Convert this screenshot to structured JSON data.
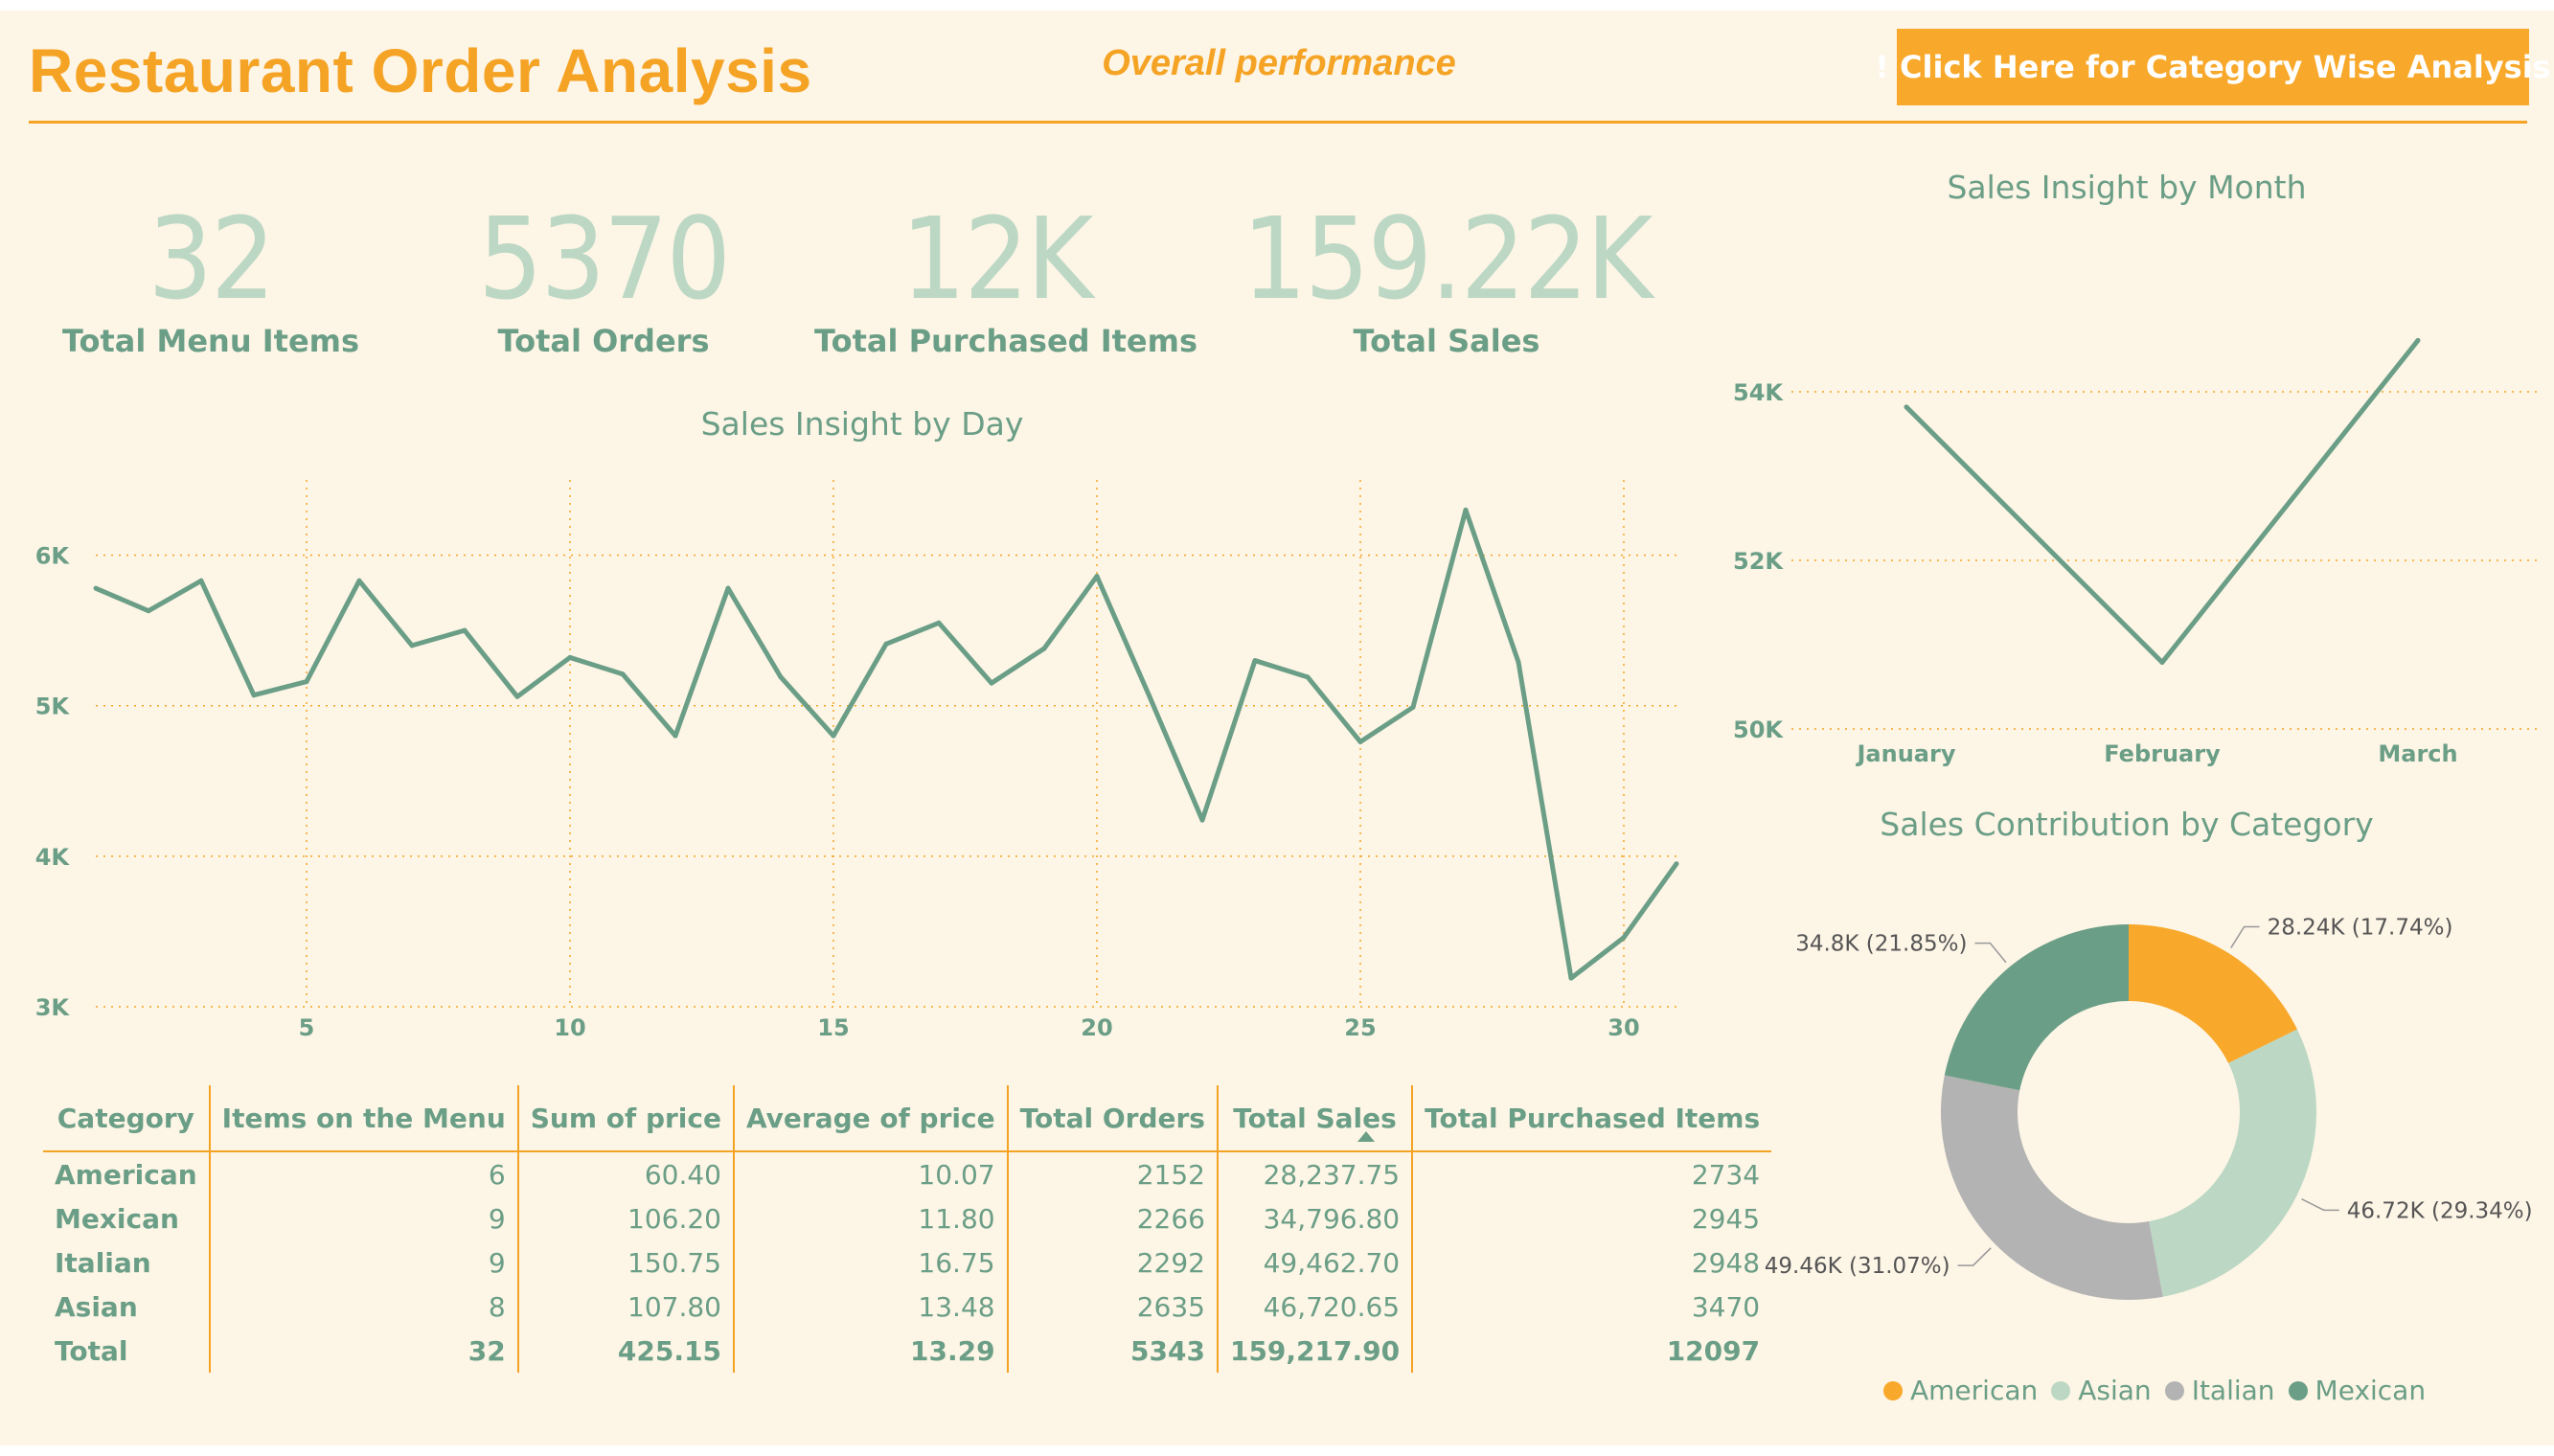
{
  "header": {
    "title": "Restaurant Order Analysis",
    "subtitle": "Overall performance",
    "cta_label": "! Click Here for Category Wise Analysis"
  },
  "kpis": [
    {
      "value": "32",
      "label": "Total Menu Items"
    },
    {
      "value": "5370",
      "label": "Total Orders"
    },
    {
      "value": "12K",
      "label": "Total Purchased Items"
    },
    {
      "value": "159.22K",
      "label": "Total Sales"
    }
  ],
  "colors": {
    "accent": "#f5a324",
    "green": "#6b9e86",
    "light_green": "#bcd8c4",
    "grey": "#b3b3b3",
    "background": "#fdf5e6"
  },
  "day_chart_title": "Sales Insight by Day",
  "month_chart_title": "Sales Insight by Month",
  "category_chart_title": "Sales Contribution by Category",
  "chart_data": [
    {
      "type": "line",
      "title": "Sales Insight by Day",
      "x": [
        1,
        2,
        3,
        4,
        5,
        6,
        7,
        8,
        9,
        10,
        11,
        12,
        13,
        14,
        15,
        16,
        17,
        18,
        19,
        20,
        21,
        22,
        23,
        24,
        25,
        26,
        27,
        28,
        29,
        30,
        31
      ],
      "y": [
        5780,
        5630,
        5830,
        5070,
        5160,
        5830,
        5400,
        5500,
        5060,
        5320,
        5210,
        4800,
        5780,
        5190,
        4800,
        5410,
        5550,
        5150,
        5380,
        5860,
        5060,
        4240,
        5300,
        5190,
        4760,
        4990,
        6300,
        5290,
        3190,
        3460,
        3950
      ],
      "x_ticks": [
        "5",
        "10",
        "15",
        "20",
        "25",
        "30"
      ],
      "x_tick_values": [
        5,
        10,
        15,
        20,
        25,
        30
      ],
      "y_ticks": [
        "3K",
        "4K",
        "5K",
        "6K"
      ],
      "y_tick_values": [
        3000,
        4000,
        5000,
        6000
      ],
      "ylim": [
        3000,
        6500
      ],
      "xlim": [
        1,
        31
      ],
      "grid": true
    },
    {
      "type": "line",
      "title": "Sales Insight by Month",
      "categories": [
        "January",
        "February",
        "March"
      ],
      "values": [
        53820,
        50790,
        54610
      ],
      "y_ticks": [
        "50K",
        "52K",
        "54K"
      ],
      "y_tick_values": [
        50000,
        52000,
        54000
      ],
      "ylim": [
        50000,
        55000
      ],
      "grid": true
    },
    {
      "type": "pie",
      "title": "Sales Contribution by Category",
      "donut": true,
      "slices": [
        {
          "name": "American",
          "value": 28.24,
          "label": "28.24K (17.74%)",
          "color": "#f8a82a"
        },
        {
          "name": "Asian",
          "value": 46.72,
          "label": "46.72K (29.34%)",
          "color": "#bcd8c4"
        },
        {
          "name": "Italian",
          "value": 49.46,
          "label": "49.46K (31.07%)",
          "color": "#b3b3b3"
        },
        {
          "name": "Mexican",
          "value": 34.8,
          "label": "34.8K (21.85%)",
          "color": "#6b9e86"
        }
      ],
      "legend": [
        "American",
        "Asian",
        "Italian",
        "Mexican"
      ],
      "legend_position": "bottom"
    },
    {
      "type": "table",
      "columns": [
        "Category",
        "Items on the Menu",
        "Sum of price",
        "Average of price",
        "Total Orders",
        "Total Sales",
        "Total Purchased Items"
      ],
      "rows": [
        [
          "American",
          "6",
          "60.40",
          "10.07",
          "2152",
          "28,237.75",
          "2734"
        ],
        [
          "Mexican",
          "9",
          "106.20",
          "11.80",
          "2266",
          "34,796.80",
          "2945"
        ],
        [
          "Italian",
          "9",
          "150.75",
          "16.75",
          "2292",
          "49,462.70",
          "2948"
        ],
        [
          "Asian",
          "8",
          "107.80",
          "13.48",
          "2635",
          "46,720.65",
          "3470"
        ]
      ],
      "total": [
        "Total",
        "32",
        "425.15",
        "13.29",
        "5343",
        "159,217.90",
        "12097"
      ]
    }
  ]
}
